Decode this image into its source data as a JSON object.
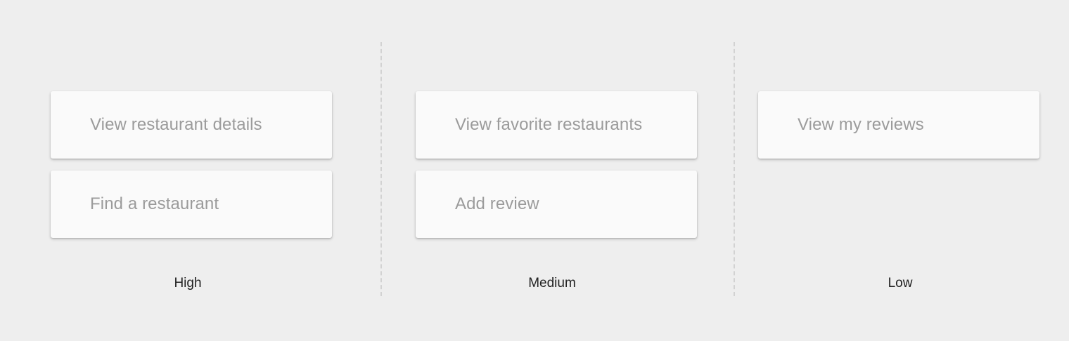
{
  "columns": [
    {
      "label": "High",
      "cards": [
        "View restaurant details",
        "Find a restaurant"
      ]
    },
    {
      "label": "Medium",
      "cards": [
        "View favorite restaurants",
        "Add review"
      ]
    },
    {
      "label": "Low",
      "cards": [
        "View my reviews"
      ]
    }
  ],
  "colors": {
    "background": "#eeeeee",
    "card": "#fafafa",
    "card_text": "#9b9b9b",
    "label_text": "#222222",
    "divider": "#d2d2d2"
  }
}
